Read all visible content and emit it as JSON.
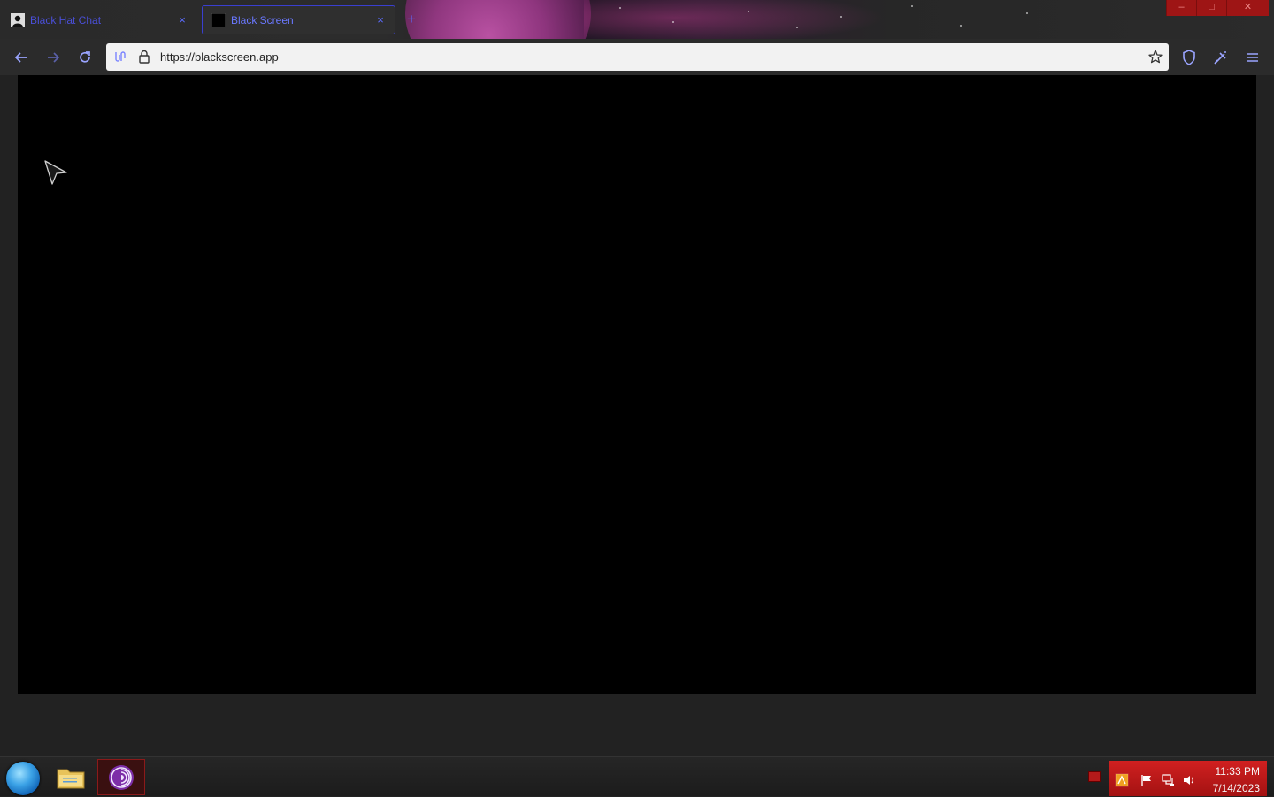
{
  "browser": {
    "tabs": [
      {
        "title": "Black Hat Chat",
        "active": false
      },
      {
        "title": "Black Screen",
        "active": true
      }
    ],
    "new_tab_label": "+",
    "close_glyph": "×",
    "url": "https://blackscreen.app"
  },
  "window_controls": {
    "minimize": "–",
    "maximize": "□",
    "close": "✕"
  },
  "taskbar": {
    "apps": [
      {
        "name": "file-explorer-icon"
      },
      {
        "name": "tor-browser-icon",
        "active": true
      }
    ],
    "clock": {
      "time": "11:33 PM",
      "date": "7/14/2023"
    }
  },
  "colors": {
    "accent": "#5b6cff",
    "tray": "#c41a1a",
    "page_background": "#000000"
  }
}
